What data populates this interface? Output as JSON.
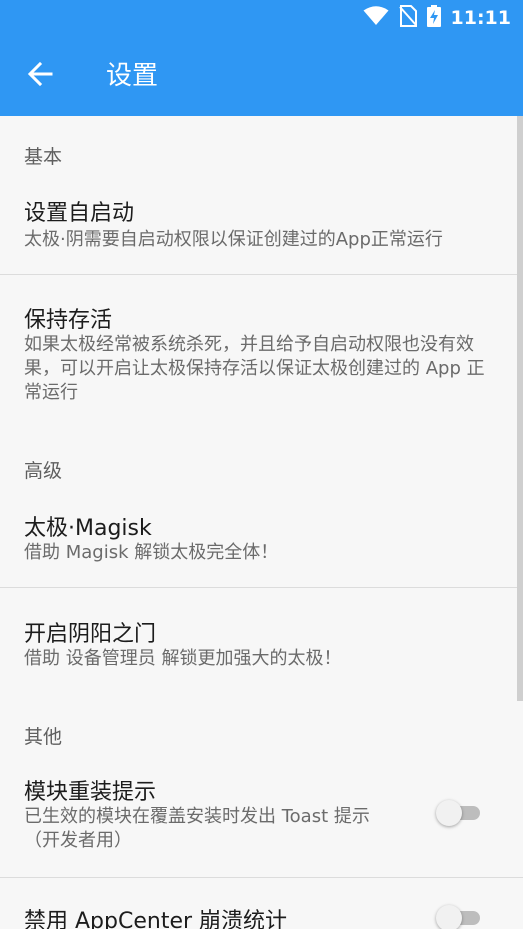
{
  "status_bar": {
    "time": "11:11",
    "icons": [
      "wifi-icon",
      "no-sim-icon",
      "battery-charging-icon"
    ]
  },
  "app_bar": {
    "back_icon": "arrow-left-icon",
    "title": "设置"
  },
  "sections": [
    {
      "header": "基本",
      "items": [
        {
          "title": "设置自启动",
          "summary": "太极·阴需要自启动权限以保证创建过的App正常运行"
        },
        {
          "title": "保持存活",
          "summary": "如果太极经常被系统杀死，并且给予自启动权限也没有效果，可以开启让太极保持存活以保证太极创建过的 App 正常运行"
        }
      ]
    },
    {
      "header": "高级",
      "items": [
        {
          "title": "太极·Magisk",
          "summary": "借助 Magisk 解锁太极完全体！"
        },
        {
          "title": "开启阴阳之门",
          "summary": "借助 设备管理员 解锁更加强大的太极！"
        }
      ]
    },
    {
      "header": "其他",
      "items": [
        {
          "title": "模块重装提示",
          "summary": "已生效的模块在覆盖安装时发出 Toast 提示（开发者用）",
          "toggle": false
        },
        {
          "title": "禁用 AppCenter 崩溃统计",
          "toggle": false
        }
      ]
    }
  ]
}
